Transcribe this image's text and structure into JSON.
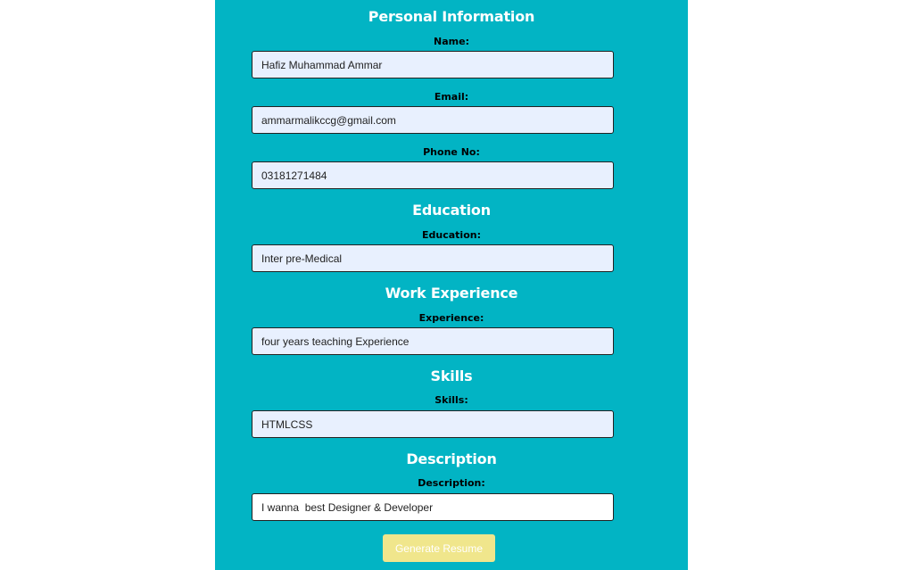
{
  "sections": {
    "personal": {
      "title": "Personal Information",
      "name_label": "Name:",
      "name_value": "Hafiz Muhammad Ammar",
      "email_label": "Email:",
      "email_value": "ammarmalikccg@gmail.com",
      "phone_label": "Phone No:",
      "phone_value": "03181271484"
    },
    "education": {
      "title": "Education",
      "label": "Education:",
      "value": "Inter pre-Medical"
    },
    "work": {
      "title": "Work Experience",
      "label": "Experience:",
      "value": "four years teaching Experience"
    },
    "skills": {
      "title": "Skills",
      "label": "Skills:",
      "value": "HTMLCSS"
    },
    "description": {
      "title": "Description",
      "label": "Description:",
      "value": "I wanna  best Designer & Developer"
    }
  },
  "actions": {
    "generate_label": "Generate Resume"
  },
  "colors": {
    "panel_background": "#02b4c4",
    "autofill_input_background": "#e8f0fe",
    "button_background": "#f0e68c",
    "heading_text": "#ffffff"
  }
}
